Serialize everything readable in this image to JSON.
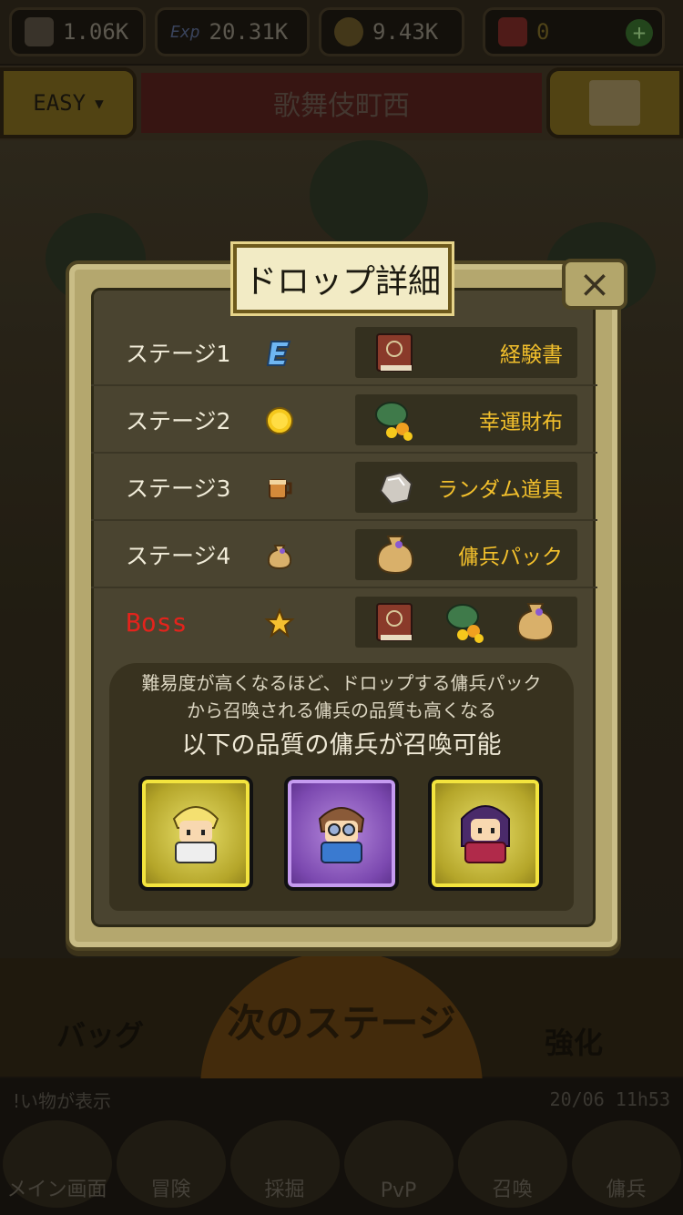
{
  "resources": {
    "attack": "1.06K",
    "exp_label": "Exp",
    "exp": "20.31K",
    "gold": "9.43K",
    "gems": "0"
  },
  "header": {
    "difficulty": "EASY",
    "area_name": "歌舞伎町西"
  },
  "modal": {
    "title": "ドロップ詳細",
    "close": "×",
    "rows": [
      {
        "label": "ステージ1",
        "icon": "exp-e-icon",
        "item": "経験書",
        "item_icon": "book-icon"
      },
      {
        "label": "ステージ2",
        "icon": "gold-coin-icon",
        "item": "幸運財布",
        "item_icon": "lucky-wallet-icon"
      },
      {
        "label": "ステージ3",
        "icon": "mug-icon",
        "item": "ランダム道具",
        "item_icon": "stone-icon"
      },
      {
        "label": "ステージ4",
        "icon": "bag-icon",
        "item": "傭兵パック",
        "item_icon": "mercenary-pack-icon"
      },
      {
        "label": "Boss",
        "icon": "star-icon",
        "items": [
          "book-icon",
          "lucky-wallet-icon",
          "mercenary-pack-icon"
        ]
      }
    ],
    "info_line1": "難易度が高くなるほど、ドロップする傭兵パック",
    "info_line2": "から召喚される傭兵の品質も高くなる",
    "info_line3": "以下の品質の傭兵が召喚可能",
    "heroes": [
      {
        "quality": "gold",
        "color": "#e8df6a"
      },
      {
        "quality": "purple",
        "color": "#9b63d0"
      },
      {
        "quality": "gold",
        "color": "#e8df6a"
      }
    ]
  },
  "actions": {
    "bag": "バッグ",
    "next_stage": "次のステージ",
    "upgrade": "強化"
  },
  "message": {
    "text": "!い物が表示",
    "time": "20/06 11h53"
  },
  "nav": {
    "items": [
      "メイン画面",
      "冒険",
      "採掘",
      "PvP",
      "召喚",
      "傭兵"
    ]
  }
}
